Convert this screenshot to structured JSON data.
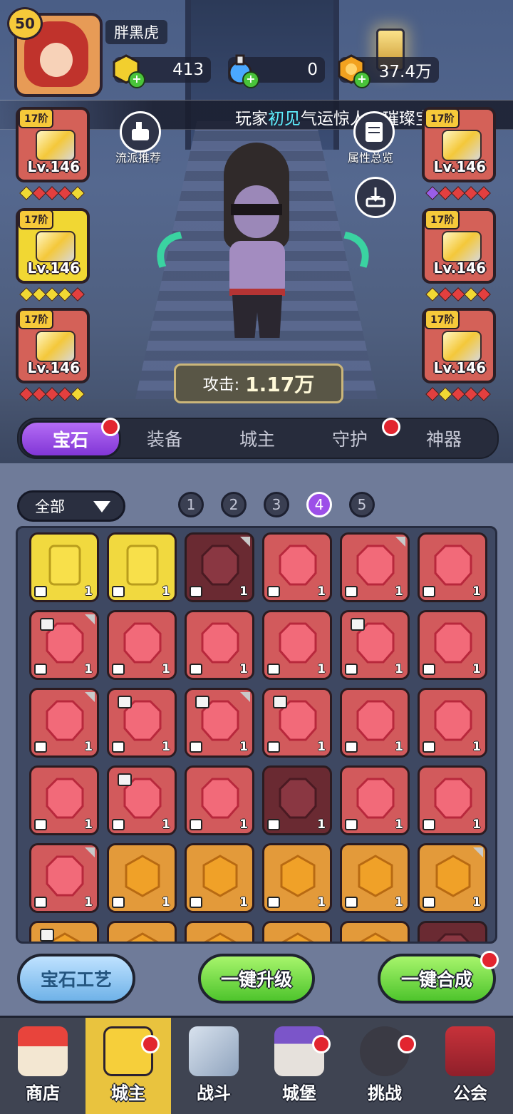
{
  "player": {
    "level": "50",
    "name": "胖黑虎"
  },
  "resources": {
    "cube": "413",
    "potion": "0",
    "gold": "37.4万"
  },
  "ticker": {
    "pre": "玩家",
    "highlight": "初见",
    "post": "气运惊人，璀璨宝箱中获"
  },
  "side_buttons": {
    "build_recommend": "流派推荐",
    "attr_overview": "属性总览"
  },
  "equipment": {
    "left": [
      {
        "tier": "17阶",
        "level": "Lv.146"
      },
      {
        "tier": "17阶",
        "level": "Lv.146"
      },
      {
        "tier": "17阶",
        "level": "Lv.146"
      }
    ],
    "right": [
      {
        "tier": "17阶",
        "level": "Lv.146"
      },
      {
        "tier": "17阶",
        "level": "Lv.146"
      },
      {
        "tier": "17阶",
        "level": "Lv.146"
      }
    ]
  },
  "attack": {
    "label": "攻击:",
    "value": "1.17万"
  },
  "tabs": [
    "宝石",
    "装备",
    "城主",
    "守护",
    "神器"
  ],
  "filter": {
    "label": "全部"
  },
  "pages": [
    "1",
    "2",
    "3",
    "4",
    "5"
  ],
  "active_page": "4",
  "gem_quantity": "1",
  "actions": {
    "craft": "宝石工艺",
    "upgrade_all": "一键升级",
    "merge_all": "一键合成"
  },
  "nav": [
    "商店",
    "城主",
    "战斗",
    "城堡",
    "挑战",
    "公会"
  ],
  "colors": {
    "accent_purple": "#9c4fe8",
    "green_button": "#4ec42c",
    "red_badge": "#e2252f"
  }
}
